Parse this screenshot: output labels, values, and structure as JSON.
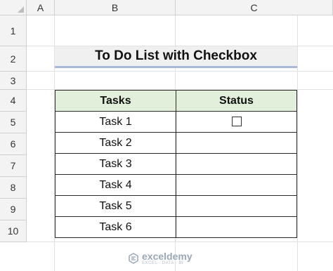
{
  "columns": [
    "A",
    "B",
    "C"
  ],
  "rows": [
    "1",
    "2",
    "3",
    "4",
    "5",
    "6",
    "7",
    "8",
    "9",
    "10"
  ],
  "title": "To Do List with Checkbox",
  "table": {
    "headers": [
      "Tasks",
      "Status"
    ],
    "tasks": [
      "Task 1",
      "Task 2",
      "Task 3",
      "Task 4",
      "Task 5",
      "Task 6"
    ]
  },
  "checkbox": {
    "checked": false
  },
  "watermark": {
    "brand": "exceldemy",
    "tagline": "EXCEL · DATA · BI"
  },
  "colors": {
    "header_fill": "#e2efda",
    "title_fill": "#f0f0f0",
    "title_underline": "#a9b8dc"
  }
}
